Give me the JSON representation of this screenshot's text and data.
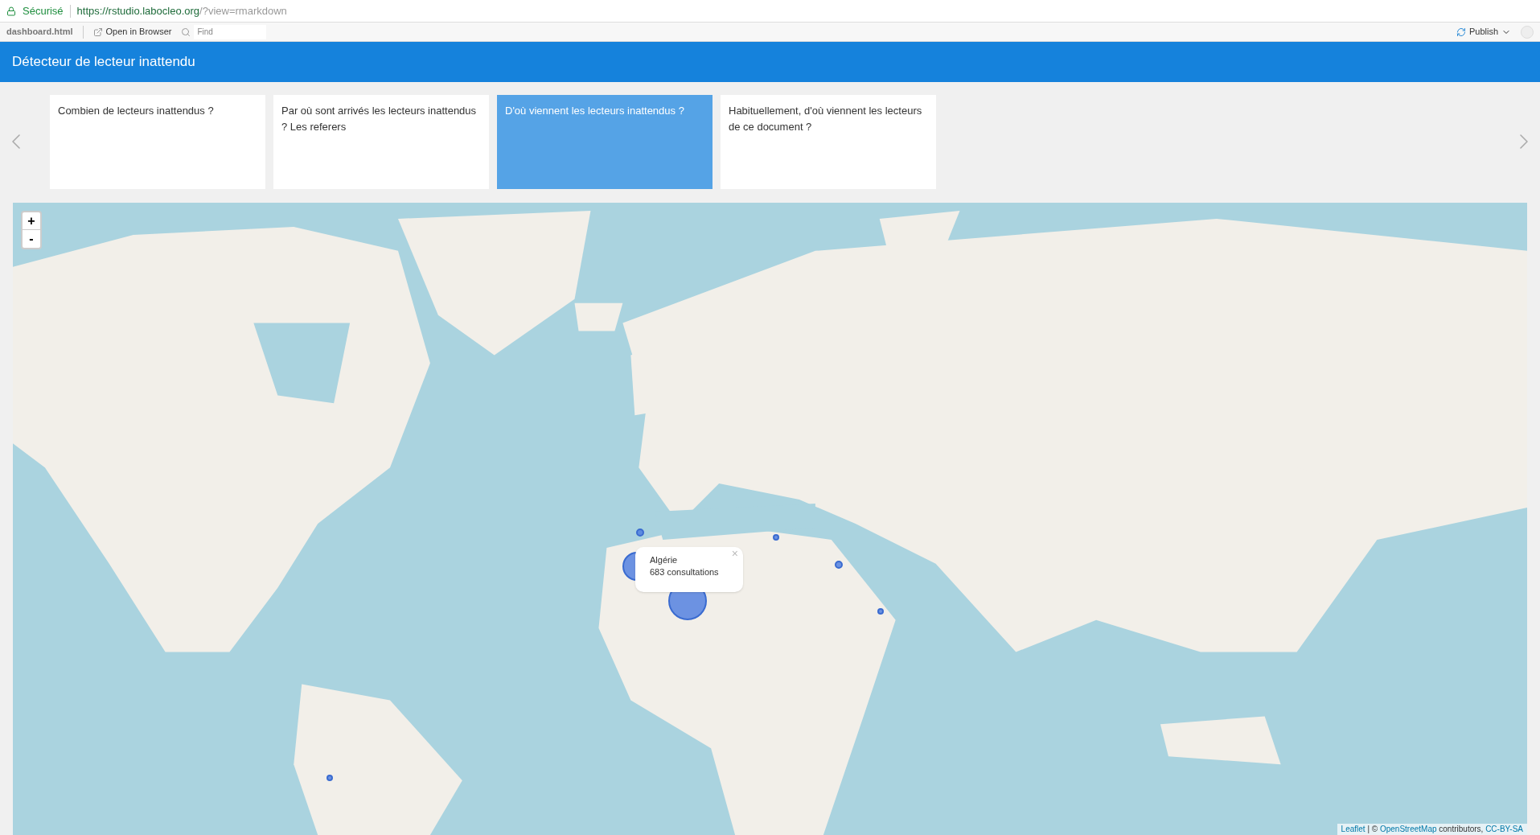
{
  "browser": {
    "secure_label": "Sécurisé",
    "url_host": "https://rstudio.labocleo.org",
    "url_path": "/?view=rmarkdown"
  },
  "toolbar": {
    "file": "dashboard.html",
    "open_button": "Open in Browser",
    "find_placeholder": "Find",
    "publish_button": "Publish"
  },
  "header": {
    "title": "Détecteur de lecteur inattendu"
  },
  "cards": [
    {
      "label": "Combien de lecteurs inattendus ?",
      "selected": false
    },
    {
      "label": "Par où sont arrivés les lecteurs inattendus ? Les referers",
      "selected": false
    },
    {
      "label": "D'où viennent les lecteurs inattendus ?",
      "selected": true
    },
    {
      "label": "Habituellement, d'où viennent les lecteurs de ce document ?",
      "selected": false
    }
  ],
  "map": {
    "zoom_in": "+",
    "zoom_out": "-",
    "popup": {
      "title": "Algérie",
      "text": "683 consultations",
      "close": "×"
    },
    "attribution": {
      "leaflet": "Leaflet",
      "middle": " | © ",
      "osm": "OpenStreetMap",
      "contributors": " contributors, ",
      "license": "CC-BY-SA"
    }
  }
}
